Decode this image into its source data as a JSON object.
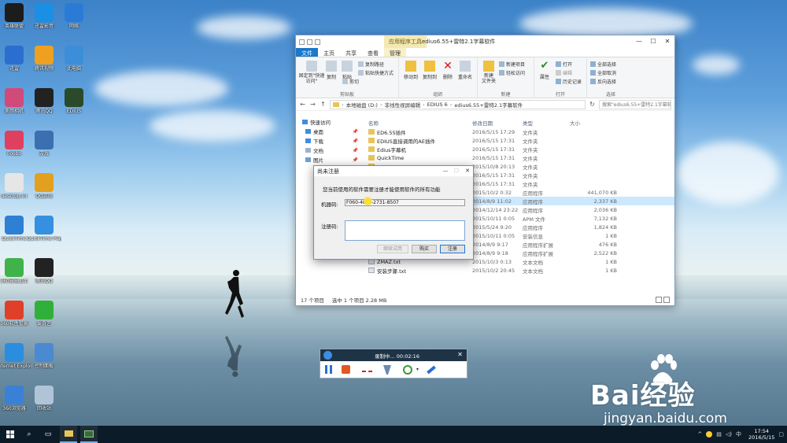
{
  "desktop": {
    "icons": [
      {
        "label": "英雄联盟",
        "color": "#1c1c1c"
      },
      {
        "label": "迅雷影音",
        "color": "#1a8fe3"
      },
      {
        "label": "网络",
        "color": "#2b7bd6"
      },
      {
        "label": "迅雷",
        "color": "#2a6fd0"
      },
      {
        "label": "腾讯视频",
        "color": "#f0a020"
      },
      {
        "label": "此电脑",
        "color": "#3c8ed8"
      },
      {
        "label": "美颜相机",
        "color": "#d04a7a"
      },
      {
        "label": "腾讯QQ",
        "color": "#222222"
      },
      {
        "label": "EDIUS",
        "color": "#2a4a2a"
      },
      {
        "label": "Foobo",
        "color": "#e04060"
      },
      {
        "label": "游戏",
        "color": "#3a6fb0"
      },
      {
        "label": "desktop.ini",
        "color": "#e6e6e6"
      },
      {
        "label": "QQ游戏",
        "color": "#e2a020"
      },
      {
        "label": "QuickTime",
        "color": "#2e7fd6"
      },
      {
        "label": "QuickTime Player",
        "color": "#3690e0"
      },
      {
        "label": "360安全卫士",
        "color": "#3fb34a"
      },
      {
        "label": "腾讯QQ",
        "color": "#222222"
      },
      {
        "label": "360软件管家",
        "color": "#e0402a"
      },
      {
        "label": "爱奇艺",
        "color": "#30b03a"
      },
      {
        "label": "Internet Explorer",
        "color": "#2a8de0"
      },
      {
        "label": "控制面板",
        "color": "#4a8ad0"
      },
      {
        "label": "360浏览器",
        "color": "#3a80d6"
      },
      {
        "label": "回收站",
        "color": "#b0c4d8"
      }
    ]
  },
  "explorer": {
    "context_tab": "应用程序工具",
    "title": "edius6.55+雷特2.1字幕软件",
    "tabs": [
      "文件",
      "主页",
      "共享",
      "查看",
      "管理"
    ],
    "ribbon": {
      "pin_label": "固定到\"快速访问\"",
      "copy_label": "复制",
      "paste_label": "粘贴",
      "copy_path": "复制路径",
      "paste_shortcut": "粘贴快捷方式",
      "cut": "剪切",
      "clipboard_group": "剪贴板",
      "move_to": "移动到",
      "copy_to": "复制到",
      "delete": "删除",
      "rename": "重命名",
      "organize_group": "组织",
      "new_folder": "新建\n文件夹",
      "new_item": "新建项目",
      "easy_access": "轻松访问",
      "new_group": "新建",
      "properties": "属性",
      "open": "打开",
      "edit": "编辑",
      "history": "历史记录",
      "open_group": "打开",
      "select_all": "全部选择",
      "select_none": "全部取消",
      "invert": "反向选择",
      "select_group": "选择"
    },
    "breadcrumb": [
      "本地磁盘 (D:)",
      "非线性视屏编辑",
      "EDIUS 6",
      "edius6.55+雷特2.1字幕软件"
    ],
    "search_placeholder": "搜索\"edius6.55+雷特2.1字幕软件\"",
    "nav": [
      {
        "label": "快速访问",
        "pin": false
      },
      {
        "label": "桌面",
        "pin": true
      },
      {
        "label": "下载",
        "pin": true
      },
      {
        "label": "文档",
        "pin": true
      },
      {
        "label": "图片",
        "pin": true
      }
    ],
    "columns": [
      "名称",
      "修改日期",
      "类型",
      "大小"
    ],
    "files": [
      {
        "name": "ED6.55插件",
        "date": "2016/5/15 17:29",
        "type": "文件夹",
        "size": ""
      },
      {
        "name": "EDIUS直接调用的AE插件",
        "date": "2016/5/15 17:31",
        "type": "文件夹",
        "size": ""
      },
      {
        "name": "Edius字幕机",
        "date": "2016/5/15 17:31",
        "type": "文件夹",
        "size": ""
      },
      {
        "name": "QuickTime",
        "date": "2016/5/15 17:31",
        "type": "文件夹",
        "size": ""
      },
      {
        "name": "",
        "date": "2015/10/8 20:13",
        "type": "文件夹",
        "size": ""
      },
      {
        "name": "",
        "date": "2016/5/15 17:31",
        "type": "文件夹",
        "size": ""
      },
      {
        "name": "",
        "date": "2016/5/15 17:31",
        "type": "文件夹",
        "size": ""
      },
      {
        "name": "",
        "date": "2015/10/2 0:32",
        "type": "应用程序",
        "size": "441,070 KB"
      },
      {
        "name": "",
        "date": "2014/8/9 11:02",
        "type": "应用程序",
        "size": "2,337 KB"
      },
      {
        "name": "",
        "date": "2014/12/14 23:22",
        "type": "应用程序",
        "size": "2,036 KB"
      },
      {
        "name": "",
        "date": "2015/10/11 0:05",
        "type": "APM 文件",
        "size": "7,132 KB"
      },
      {
        "name": "",
        "date": "2015/5/24 9:20",
        "type": "应用程序",
        "size": "1,824 KB"
      },
      {
        "name": "",
        "date": "2015/10/11 0:05",
        "type": "安装信息",
        "size": "1 KB"
      },
      {
        "name": "",
        "date": "2014/8/9 9:17",
        "type": "应用程序扩展",
        "size": "476 KB"
      },
      {
        "name": "",
        "date": "2014/8/9 9:18",
        "type": "应用程序扩展",
        "size": "2,522 KB"
      },
      {
        "name": "ZMAZ.txt",
        "date": "2015/10/3 0:13",
        "type": "文本文档",
        "size": "1 KB"
      },
      {
        "name": "安装步骤.txt",
        "date": "2015/10/2 20:45",
        "type": "文本文档",
        "size": "1 KB"
      }
    ],
    "status_count": "17 个项目",
    "status_selected": "选中 1 个项目  2.28 MB"
  },
  "dialog": {
    "title": "尚未注册",
    "message": "您当前使用的软件需要注册才能使用软件的所有功能",
    "machine_label": "机器码:",
    "machine_code": "F060-40F1-2731-8507",
    "reg_label": "注册码:",
    "btn_trial": "继续试用",
    "btn_buy": "购买",
    "btn_register": "注册"
  },
  "recorder": {
    "status": "录制中... 00:02:16"
  },
  "taskbar": {
    "time": "17:54",
    "date": "2016/5/15"
  },
  "watermark": {
    "brand": "Bai经验",
    "url": "jingyan.baidu.com"
  }
}
